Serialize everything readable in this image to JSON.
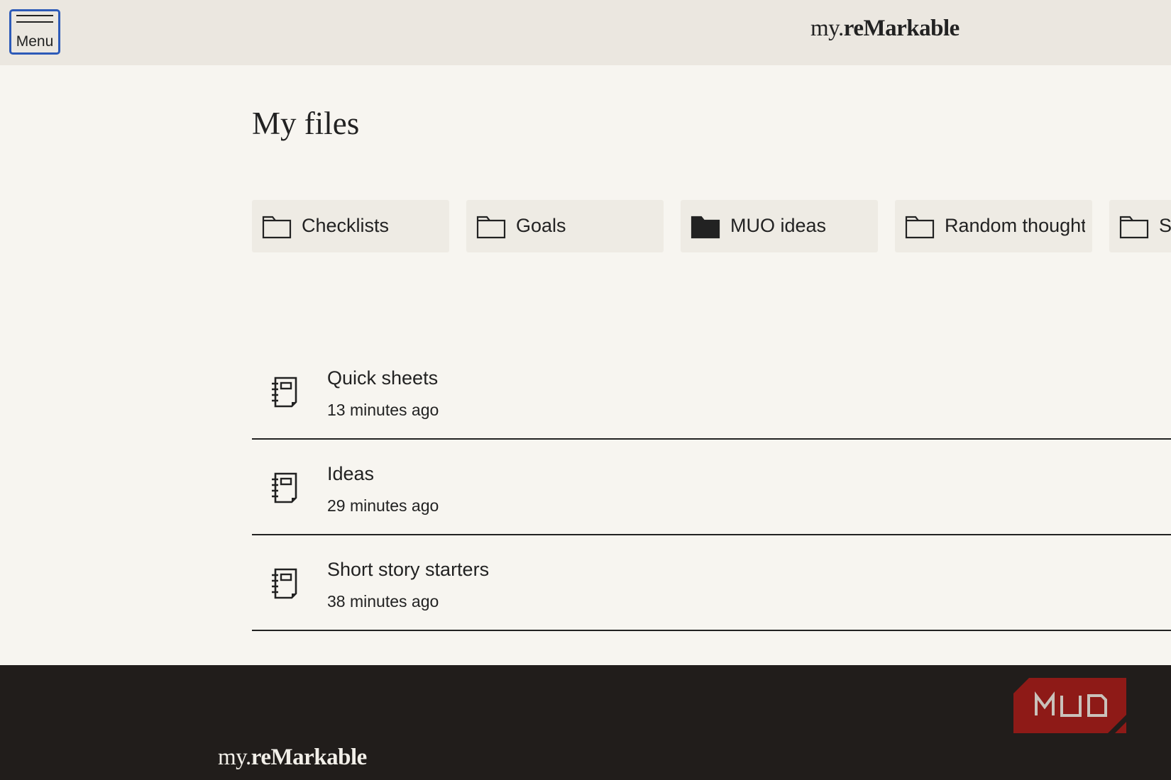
{
  "header": {
    "menu_label": "Menu",
    "brand_prefix": "my.",
    "brand_name": "reMarkable"
  },
  "main": {
    "title": "My files",
    "folders": [
      {
        "name": "Checklists",
        "icon": "folder-outline-icon"
      },
      {
        "name": "Goals",
        "icon": "folder-outline-icon"
      },
      {
        "name": "MUO ideas",
        "icon": "folder-filled-icon"
      },
      {
        "name": "Random thoughts",
        "icon": "folder-outline-icon"
      },
      {
        "name": "S",
        "icon": "folder-outline-icon"
      }
    ],
    "files": [
      {
        "name": "Quick sheets",
        "modified": "13 minutes ago",
        "icon": "notebook-icon"
      },
      {
        "name": "Ideas",
        "modified": "29 minutes ago",
        "icon": "notebook-icon"
      },
      {
        "name": "Short story starters",
        "modified": "38 minutes ago",
        "icon": "notebook-icon"
      }
    ]
  },
  "footer": {
    "brand_prefix": "my.",
    "brand_name": "reMarkable",
    "watermark": "MUO"
  },
  "colors": {
    "header_bg": "#ebe7e0",
    "page_bg": "#f7f5f0",
    "card_bg": "#eeebe4",
    "footer_bg": "#211d1b",
    "menu_focus": "#2d5ab8",
    "watermark": "#8e1a17"
  }
}
